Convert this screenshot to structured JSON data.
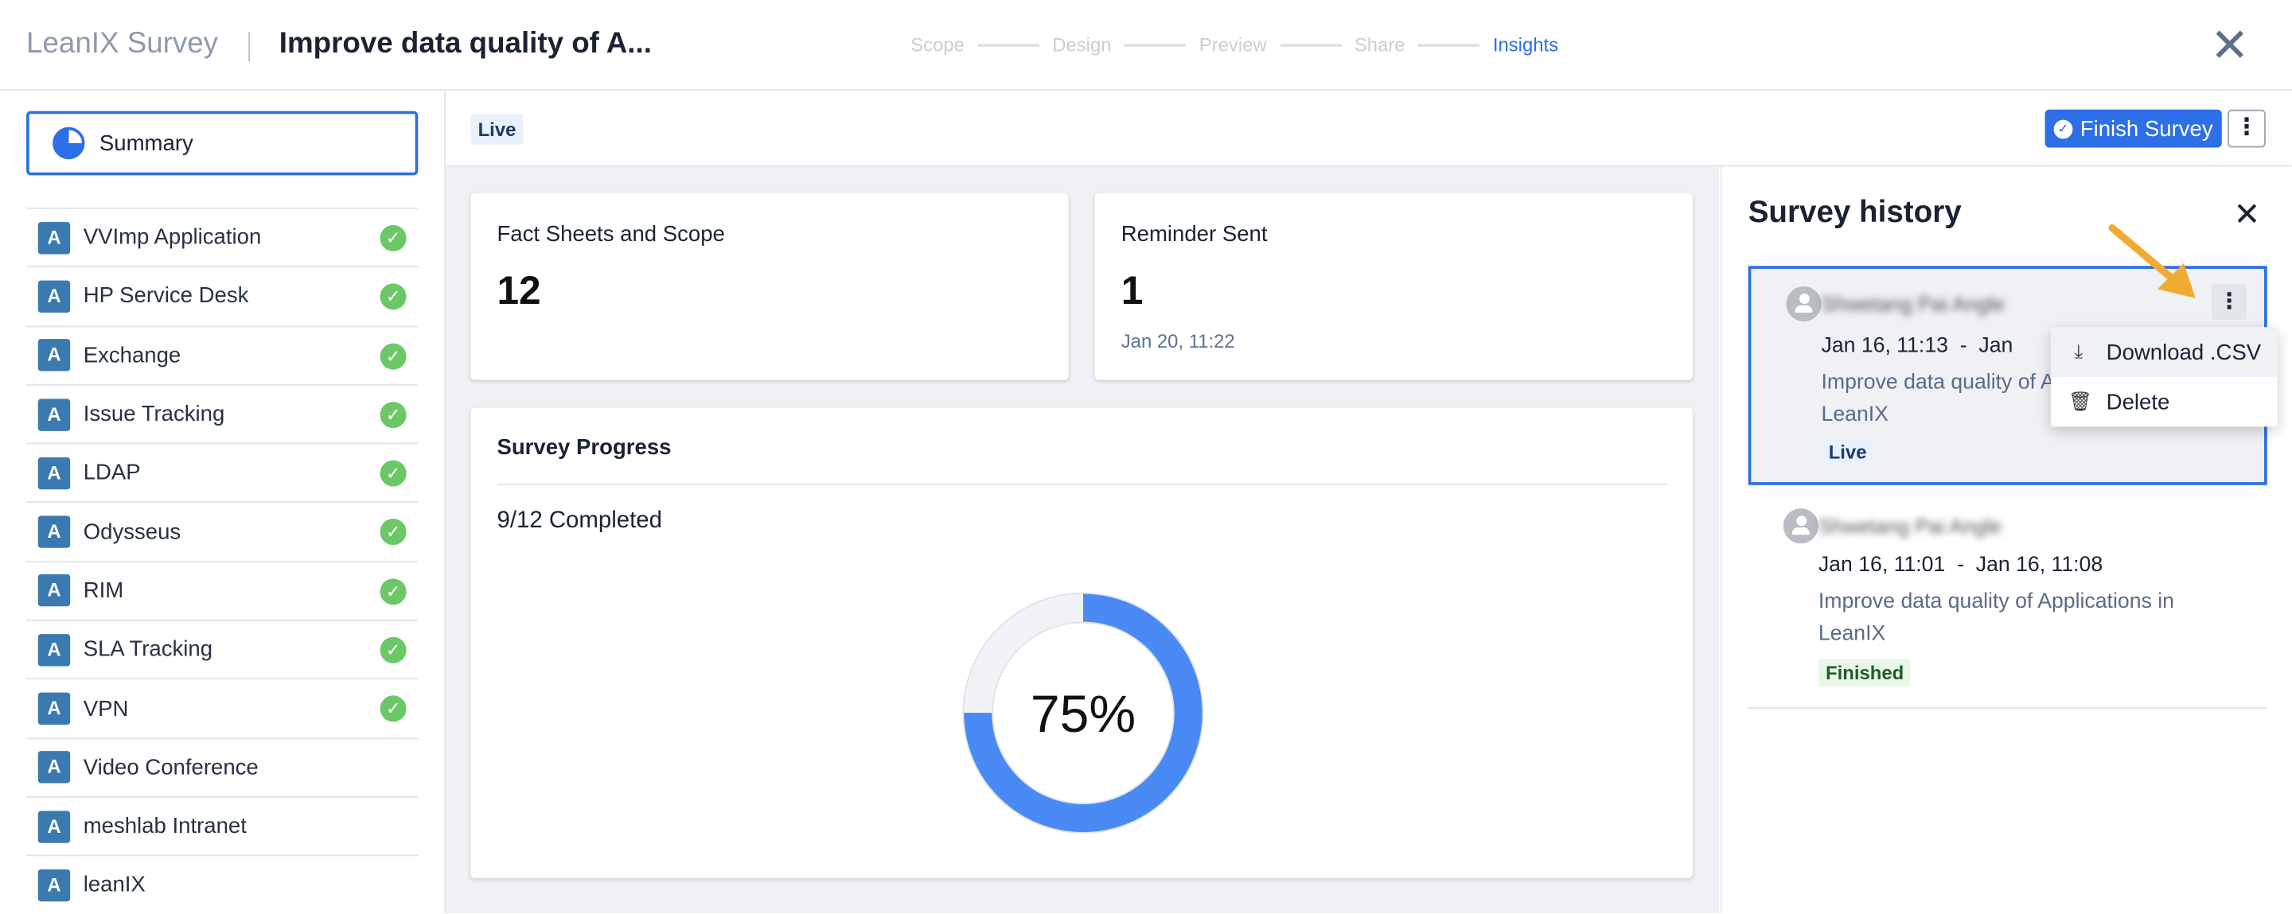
{
  "header": {
    "app_name": "LeanIX Survey",
    "survey_title": "Improve data quality of A...",
    "steps": [
      "Scope",
      "Design",
      "Preview",
      "Share",
      "Insights"
    ],
    "active_step": "Insights",
    "close_icon": "close-icon"
  },
  "sidebar": {
    "summary_label": "Summary",
    "items": [
      {
        "label": "VVImp Application",
        "type": "A",
        "done": true
      },
      {
        "label": "HP Service Desk",
        "type": "A",
        "done": true
      },
      {
        "label": "Exchange",
        "type": "A",
        "done": true
      },
      {
        "label": "Issue Tracking",
        "type": "A",
        "done": true
      },
      {
        "label": "LDAP",
        "type": "A",
        "done": true
      },
      {
        "label": "Odysseus",
        "type": "A",
        "done": true
      },
      {
        "label": "RIM",
        "type": "A",
        "done": true
      },
      {
        "label": "SLA Tracking",
        "type": "A",
        "done": true
      },
      {
        "label": "VPN",
        "type": "A",
        "done": true
      },
      {
        "label": "Video Conference",
        "type": "A",
        "done": false
      },
      {
        "label": "meshlab Intranet",
        "type": "A",
        "done": false
      },
      {
        "label": "leanIX",
        "type": "A",
        "done": false
      }
    ]
  },
  "topbar": {
    "status": "Live",
    "finish_label": "Finish Survey"
  },
  "cards": {
    "fact_sheets": {
      "label": "Fact Sheets and Scope",
      "value": "12"
    },
    "reminder": {
      "label": "Reminder Sent",
      "value": "1",
      "date": "Jan 20, 11:22"
    }
  },
  "progress": {
    "title": "Survey Progress",
    "completed_text": "9/12 Completed",
    "percent_label": "75%",
    "percent": 75,
    "color": "#4a8af4"
  },
  "history": {
    "title": "Survey history",
    "items": [
      {
        "name": "Shwetang Pai Angle",
        "dates": "Jan 16, 11:13  -  Jan",
        "desc": "Improve data quality of Applications in LeanIX",
        "status": "Live"
      },
      {
        "name": "Shwetang Pai Angle",
        "dates": "Jan 16, 11:01  -  Jan 16, 11:08",
        "desc": "Improve data quality of Applications in LeanIX",
        "status": "Finished"
      }
    ],
    "menu": {
      "download": "Download .CSV",
      "delete": "Delete"
    }
  }
}
